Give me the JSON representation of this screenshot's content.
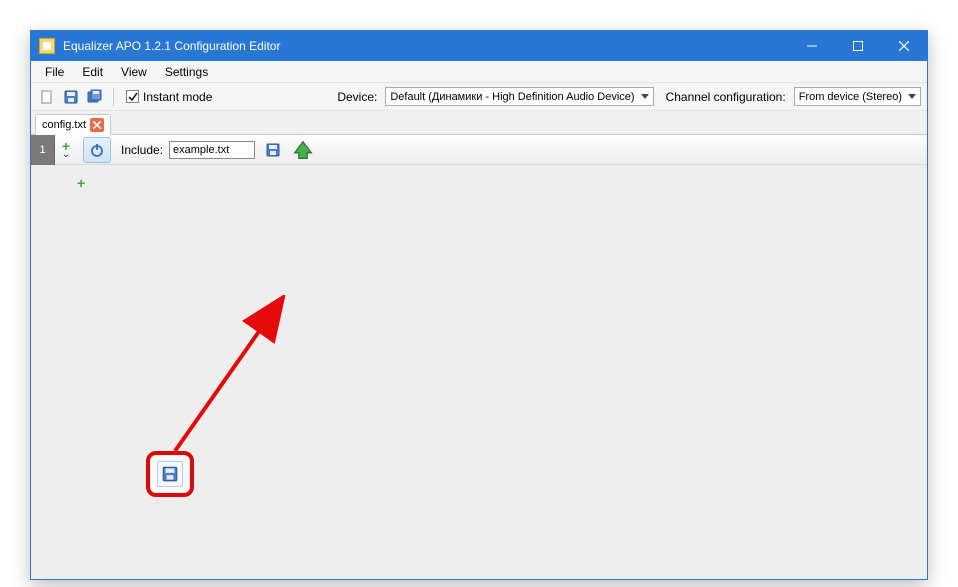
{
  "window": {
    "title": "Equalizer APO 1.2.1 Configuration Editor"
  },
  "menu": {
    "file": "File",
    "edit": "Edit",
    "view": "View",
    "settings": "Settings"
  },
  "toolbar": {
    "instant_mode_label": "Instant mode",
    "instant_mode_checked": true,
    "device_label": "Device:",
    "device_value": "Default (Динамики - High Definition Audio Device)",
    "channel_config_label": "Channel configuration:",
    "channel_config_value": "From device (Stereo)"
  },
  "tabs": {
    "config_tab": "config.txt"
  },
  "filter_row": {
    "index": "1",
    "include_label": "Include:",
    "include_value": "example.txt"
  },
  "icons": {
    "new": "new-file-icon",
    "save": "save-icon",
    "save_all": "save-all-icon",
    "open_folder": "open-folder-icon",
    "arrow_up": "arrow-up-icon"
  }
}
